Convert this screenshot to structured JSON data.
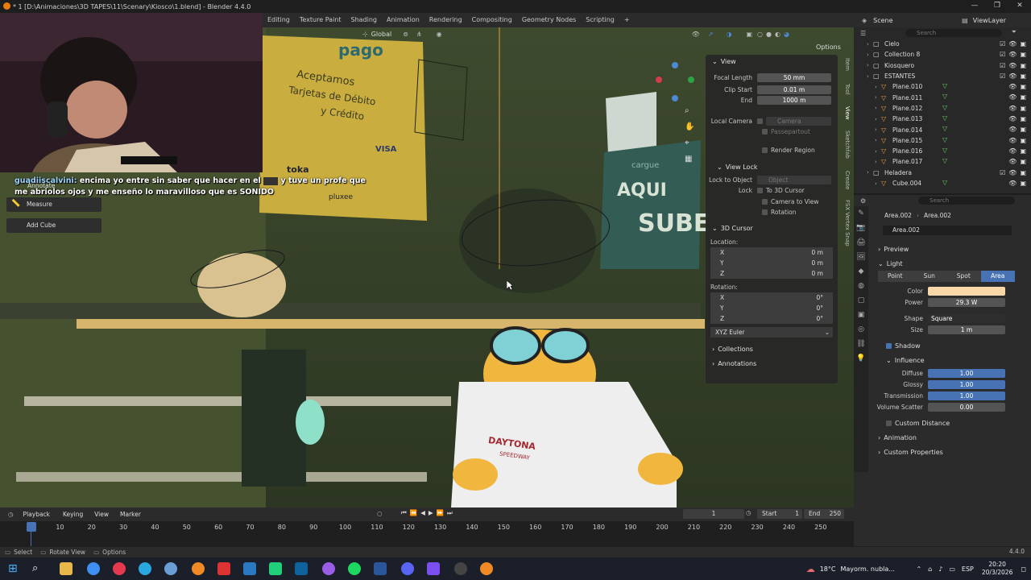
{
  "window": {
    "title": "* 1 [D:\\Animaciones\\3D TAPES\\11\\Scenary\\Kiosco\\1.blend] - Blender 4.4.0",
    "controls": [
      "—",
      "❐",
      "✕"
    ]
  },
  "workspaces": [
    "Editing",
    "Texture Paint",
    "Shading",
    "Animation",
    "Rendering",
    "Compositing",
    "Geometry Nodes",
    "Scripting",
    "+"
  ],
  "scene": {
    "label": "Scene",
    "view_layer": "ViewLayer"
  },
  "viewport_header": {
    "orientation": "Global",
    "options_label": "Options"
  },
  "chat": {
    "username": "guadiiscalvini:",
    "message_line1": "encima yo entre sin saber que hacer en el",
    "message_line1b": "y tuve un profe que",
    "message_line2": "me abriolos ojos y me enseño lo maravilloso que es SONIDO"
  },
  "tools": {
    "annotate": "Annotate",
    "measure": "Measure",
    "add_cube": "Add Cube"
  },
  "scene_text": {
    "logo": "pago",
    "sign_line1": "Aceptamos",
    "sign_line2": "Tarjetas de Débito",
    "sign_line3": "y Crédito",
    "brand1": "VISA",
    "brand2": "toka",
    "brand3": "pluxee",
    "cargue": "cargue",
    "aqui": "AQUI",
    "sube": "SUBE",
    "shirt1": "DAYTONA",
    "shirt2": "SPEEDWAY"
  },
  "npanel": {
    "view_header": "View",
    "focal_length_label": "Focal Length",
    "focal_length": "50 mm",
    "clip_start_label": "Clip Start",
    "clip_start": "0.01 m",
    "end_label": "End",
    "end": "1000 m",
    "local_camera_label": "Local Camera",
    "local_camera_value": "Camera",
    "passepartout": "Passepartout",
    "render_region": "Render Region",
    "view_lock_header": "View Lock",
    "lock_to_object_label": "Lock to Object",
    "lock_to_object_value": "Object",
    "lock_label": "Lock",
    "to_3d_cursor": "To 3D Cursor",
    "camera_to_view": "Camera to View",
    "rotation_lock": "Rotation",
    "cursor_header": "3D Cursor",
    "location_label": "Location:",
    "loc_x": "0 m",
    "loc_y": "0 m",
    "loc_z": "0 m",
    "rotation_label": "Rotation:",
    "rot_x": "0°",
    "rot_y": "0°",
    "rot_z": "0°",
    "euler": "XYZ Euler",
    "collections": "Collections",
    "annotations": "Annotations",
    "axis_x": "X",
    "axis_y": "Y",
    "axis_z": "Z"
  },
  "side_tabs": [
    "Item",
    "Tool",
    "View",
    "Sketchfab",
    "Create",
    "FSX Vertex Snap"
  ],
  "outliner": {
    "search_placeholder": "Search",
    "rows": [
      {
        "name": "Cielo",
        "indent": 1,
        "kind": "collection"
      },
      {
        "name": "Collection 8",
        "indent": 1,
        "kind": "collection"
      },
      {
        "name": "Kiosquero",
        "indent": 1,
        "kind": "collection"
      },
      {
        "name": "ESTANTES",
        "indent": 1,
        "kind": "collection"
      },
      {
        "name": "Plane.010",
        "indent": 2,
        "kind": "object"
      },
      {
        "name": "Plane.011",
        "indent": 2,
        "kind": "object"
      },
      {
        "name": "Plane.012",
        "indent": 2,
        "kind": "object"
      },
      {
        "name": "Plane.013",
        "indent": 2,
        "kind": "object"
      },
      {
        "name": "Plane.014",
        "indent": 2,
        "kind": "object"
      },
      {
        "name": "Plane.015",
        "indent": 2,
        "kind": "object"
      },
      {
        "name": "Plane.016",
        "indent": 2,
        "kind": "object"
      },
      {
        "name": "Plane.017",
        "indent": 2,
        "kind": "object"
      },
      {
        "name": "Heladera",
        "indent": 1,
        "kind": "collection"
      },
      {
        "name": "Cube.004",
        "indent": 2,
        "kind": "object"
      }
    ]
  },
  "properties": {
    "search_placeholder": "Search",
    "breadcrumb_obj": "Area.002",
    "breadcrumb_data": "Area.002",
    "datablock": "Area.002",
    "preview": "Preview",
    "light": "Light",
    "light_types": [
      "Point",
      "Sun",
      "Spot",
      "Area"
    ],
    "color_label": "Color",
    "power_label": "Power",
    "power": "29.3 W",
    "shape_label": "Shape",
    "shape": "Square",
    "size_label": "Size",
    "size": "1 m",
    "shadow": "Shadow",
    "influence": "Influence",
    "diffuse_label": "Diffuse",
    "diffuse": "1.00",
    "glossy_label": "Glossy",
    "glossy": "1.00",
    "transmission_label": "Transmission",
    "transmission": "1.00",
    "volume_label": "Volume Scatter",
    "volume": "0.00",
    "custom_distance": "Custom Distance",
    "animation": "Animation",
    "custom_properties": "Custom Properties",
    "light_color": "#f8d7a8"
  },
  "timeline": {
    "playback": "Playback",
    "keying": "Keying",
    "view": "View",
    "marker": "Marker",
    "current_frame": "1",
    "start_label": "Start",
    "start": "1",
    "end_label": "End",
    "end": "250",
    "ticks": [
      "1",
      "10",
      "20",
      "30",
      "40",
      "50",
      "60",
      "70",
      "80",
      "90",
      "100",
      "110",
      "120",
      "130",
      "140",
      "150",
      "160",
      "170",
      "180",
      "190",
      "200",
      "210",
      "220",
      "230",
      "240",
      "250"
    ]
  },
  "statusbar": {
    "select": "Select",
    "rotate": "Rotate View",
    "options": "Options",
    "version": "4.4.0"
  },
  "taskbar": {
    "weather_temp": "18°C",
    "weather_text": "Mayorm. nubla...",
    "lang": "ESP",
    "time": "20:20",
    "date": "20/3/2026"
  },
  "colors": {
    "accent": "#4772b3",
    "orange": "#e87d0d",
    "header": "#2b2b2b"
  }
}
